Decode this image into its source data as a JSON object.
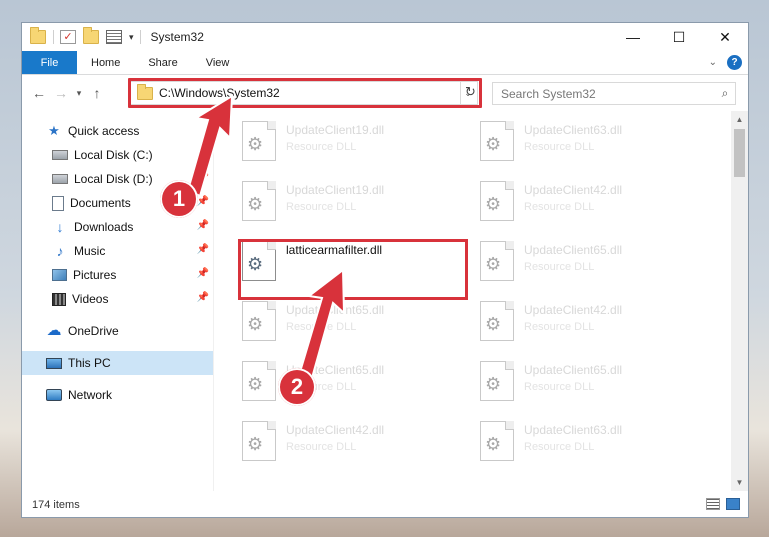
{
  "window": {
    "title": "System32",
    "controls": {
      "minimize": "—",
      "maximize": "☐",
      "close": "✕"
    }
  },
  "ribbon": {
    "tabs": [
      "File",
      "Home",
      "Share",
      "View"
    ],
    "help": "?"
  },
  "navigation": {
    "address": "C:\\Windows\\System32",
    "search_placeholder": "Search System32"
  },
  "sidebar": {
    "quick_access": "Quick access",
    "quick_items": [
      {
        "label": "Local Disk (C:)"
      },
      {
        "label": "Local Disk (D:)"
      },
      {
        "label": "Documents"
      },
      {
        "label": "Downloads"
      },
      {
        "label": "Music"
      },
      {
        "label": "Pictures"
      },
      {
        "label": "Videos"
      }
    ],
    "onedrive": "OneDrive",
    "this_pc": "This PC",
    "network": "Network"
  },
  "files": {
    "items": [
      {
        "name": "UpdateClient19.dll",
        "type": "Resource DLL"
      },
      {
        "name": "UpdateClient63.dll",
        "type": "Resource DLL"
      },
      {
        "name": "UpdateClient19.dll",
        "type": "Resource DLL"
      },
      {
        "name": "UpdateClient42.dll",
        "type": "Resource DLL"
      },
      {
        "name": "latticearmafilter.dll",
        "type": ""
      },
      {
        "name": "UpdateClient65.dll",
        "type": "Resource DLL"
      },
      {
        "name": "UpdateClient65.dll",
        "type": "Resource DLL"
      },
      {
        "name": "UpdateClient42.dll",
        "type": "Resource DLL"
      },
      {
        "name": "UpdateClient65.dll",
        "type": "Resource DLL"
      },
      {
        "name": "UpdateClient65.dll",
        "type": "Resource DLL"
      },
      {
        "name": "UpdateClient42.dll",
        "type": "Resource DLL"
      },
      {
        "name": "UpdateClient63.dll",
        "type": "Resource DLL"
      }
    ]
  },
  "status": {
    "item_count": "174 items"
  },
  "callouts": {
    "one": "1",
    "two": "2"
  },
  "colors": {
    "accent": "#1979ca",
    "highlight": "#d8323b",
    "selected_nav": "#cce4f7"
  }
}
